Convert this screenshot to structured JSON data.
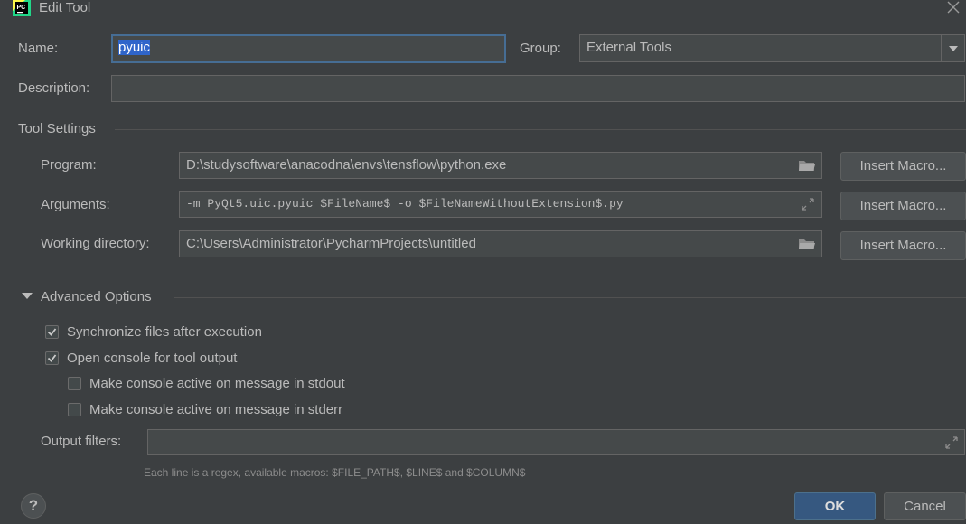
{
  "window": {
    "title": "Edit Tool",
    "app_icon_text": "PC"
  },
  "form": {
    "name_label": "Name:",
    "name_value": "pyuic",
    "group_label": "Group:",
    "group_value": "External Tools",
    "description_label": "Description:",
    "description_value": ""
  },
  "tool_settings": {
    "section_label": "Tool Settings",
    "program_label": "Program:",
    "program_value": "D:\\studysoftware\\anacodna\\envs\\tensflow\\python.exe",
    "arguments_label": "Arguments:",
    "arguments_value": "-m PyQt5.uic.pyuic $FileName$ -o $FileNameWithoutExtension$.py",
    "workdir_label": "Working directory:",
    "workdir_value": "C:\\Users\\Administrator\\PycharmProjects\\untitled",
    "insert_macro_label": "Insert Macro..."
  },
  "advanced": {
    "section_label": "Advanced Options",
    "sync_label": "Synchronize files after execution",
    "sync_checked": true,
    "console_label": "Open console for tool output",
    "console_checked": true,
    "stdout_label": "Make console active on message in stdout",
    "stdout_checked": false,
    "stderr_label": "Make console active on message in stderr",
    "stderr_checked": false,
    "output_filters_label": "Output filters:",
    "output_filters_value": "",
    "hint": "Each line is a regex, available macros: $FILE_PATH$, $LINE$ and $COLUMN$"
  },
  "footer": {
    "help_label": "?",
    "ok_label": "OK",
    "cancel_label": "Cancel"
  },
  "colors": {
    "background": "#3c3f41",
    "field_bg": "#45494a",
    "focus_border": "#466d94",
    "selection": "#2f65ca",
    "primary_button": "#365880"
  }
}
